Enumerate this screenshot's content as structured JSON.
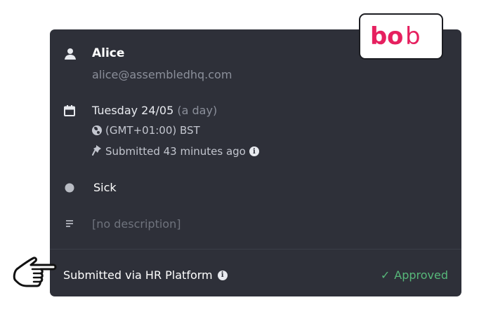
{
  "user": {
    "name": "Alice",
    "email": "alice@assembledhq.com"
  },
  "timeoff": {
    "date": "Tuesday 24/05",
    "duration": "(a day)",
    "timezone": "(GMT+01:00) BST",
    "submitted": "Submitted 43 minutes ago",
    "type": "Sick",
    "description": "[no description]"
  },
  "footer": {
    "source": "Submitted via HR Platform",
    "status": "Approved",
    "status_mark": "✓"
  },
  "logo": {
    "text": "bob",
    "accent": "#e6205f"
  },
  "colors": {
    "card_background": "#2e3039",
    "approved": "#57b87a",
    "muted_text": "#8b8f9a",
    "type_dot": "#b9bcc4"
  },
  "icons": [
    "user-icon",
    "calendar-icon",
    "globe-icon",
    "pin-icon",
    "info-icon",
    "status-dot-icon",
    "description-icon",
    "pointing-hand-icon"
  ]
}
